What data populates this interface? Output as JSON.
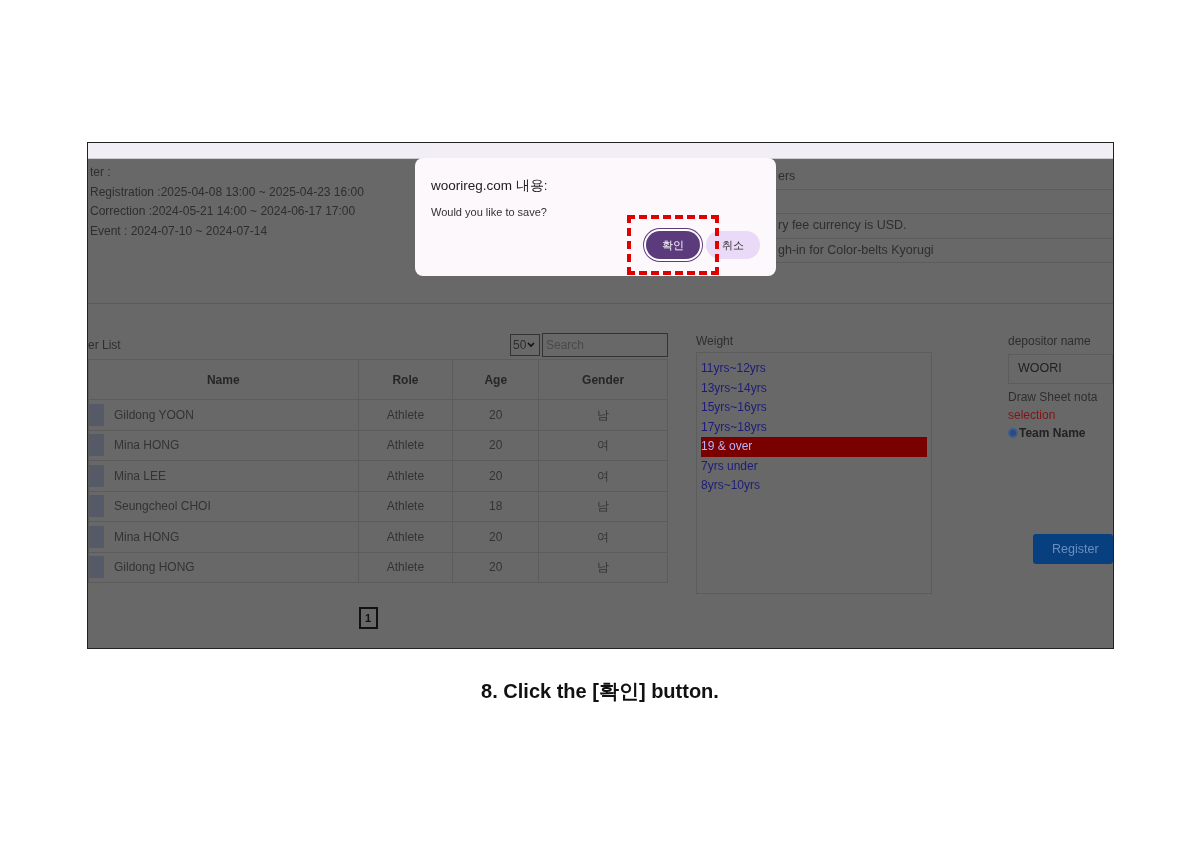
{
  "screen": {
    "schedule": {
      "heading": "ter :",
      "lines": [
        "Registration :2025-04-08 13:00 ~ 2025-04-23 16:00",
        "Correction :2024-05-21 14:00 ~ 2024-06-17 17:00",
        "Event : 2024-07-10 ~ 2024-07-14"
      ]
    },
    "notices": [
      "ers",
      "ry fee currency is USD.",
      "gh-in for Color-belts Kyorugi"
    ],
    "list": {
      "title": "er List",
      "page_size": "50",
      "search_placeholder": "Search",
      "columns": [
        "Name",
        "Role",
        "Age",
        "Gender"
      ],
      "rows": [
        {
          "name": "Gildong YOON",
          "role": "Athlete",
          "age": "20",
          "gender": "남"
        },
        {
          "name": "Mina HONG",
          "role": "Athlete",
          "age": "20",
          "gender": "여"
        },
        {
          "name": "Mina LEE",
          "role": "Athlete",
          "age": "20",
          "gender": "여"
        },
        {
          "name": "Seungcheol CHOI",
          "role": "Athlete",
          "age": "18",
          "gender": "남"
        },
        {
          "name": "Mina HONG",
          "role": "Athlete",
          "age": "20",
          "gender": "여"
        },
        {
          "name": "Gildong HONG",
          "role": "Athlete",
          "age": "20",
          "gender": "남"
        }
      ],
      "pages": [
        {
          "label": "1",
          "selected": true
        }
      ]
    },
    "weight": {
      "label": "Weight",
      "options": [
        {
          "label": "11yrs~12yrs",
          "selected": false
        },
        {
          "label": "13yrs~14yrs",
          "selected": false
        },
        {
          "label": "15yrs~16yrs",
          "selected": false
        },
        {
          "label": "17yrs~18yrs",
          "selected": false
        },
        {
          "label": "19 & over",
          "selected": true
        },
        {
          "label": "7yrs under",
          "selected": false
        },
        {
          "label": "8yrs~10yrs",
          "selected": false
        }
      ]
    },
    "depositor": {
      "label": "depositor name",
      "value": "WOORI"
    },
    "draw_sheet": {
      "label": "Draw Sheet nota",
      "hint": "selection",
      "options": [
        {
          "label": "Team Name",
          "selected": true
        }
      ]
    },
    "register_button": "Register",
    "dialog": {
      "title": "woorireg.com 내용:",
      "message": "Would you like to save?",
      "buttons": [
        {
          "label": "확인",
          "kind": "primary",
          "highlighted": true
        },
        {
          "label": "취소",
          "kind": "secondary",
          "highlighted": false
        }
      ]
    }
  },
  "caption": "8. Click the [확인] button."
}
